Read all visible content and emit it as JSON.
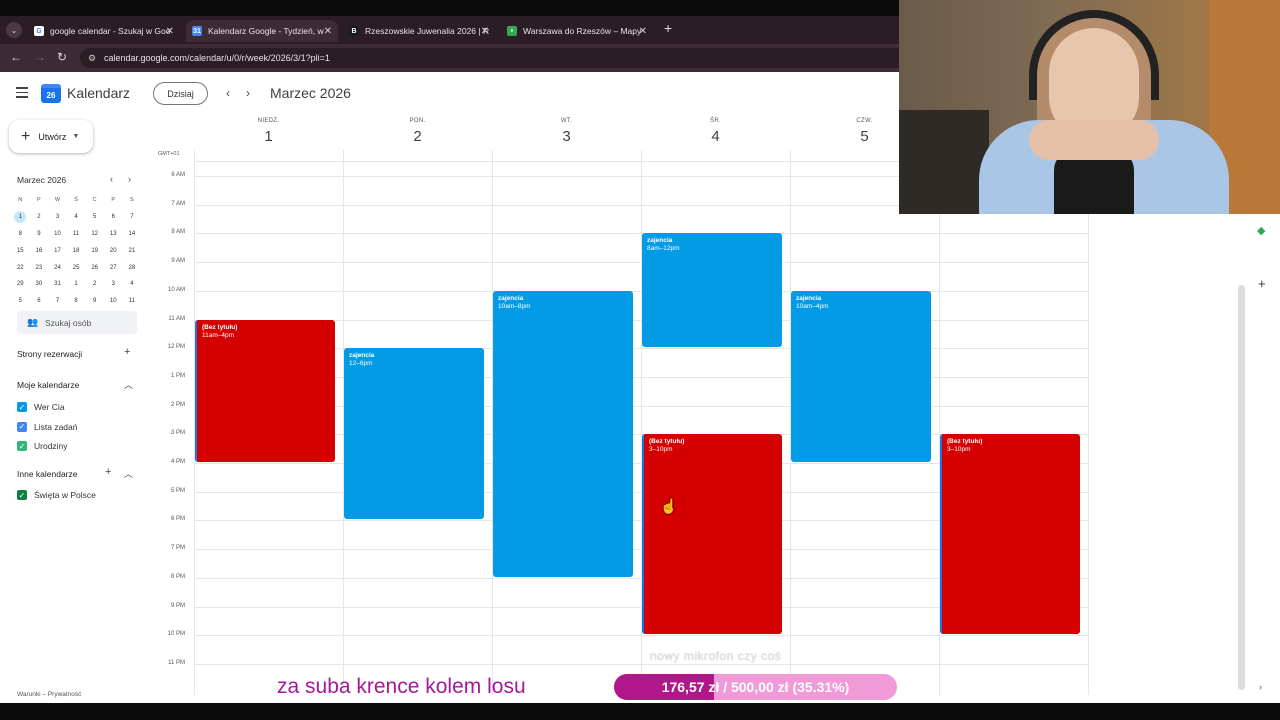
{
  "browser": {
    "tabs": [
      {
        "title": "google calendar - Szukaj w Goo",
        "fav_color": "#ffffff",
        "fav_text": "G"
      },
      {
        "title": "Kalendarz Google - Tydzień, w",
        "fav_color": "#4285f4",
        "fav_text": "31"
      },
      {
        "title": "Rzeszowskie Juwenalia 2026 | R",
        "fav_color": "#1b1b1b",
        "fav_text": "B"
      },
      {
        "title": "Warszawa do Rzeszów – Mapy",
        "fav_color": "#34a853",
        "fav_text": "•"
      }
    ],
    "active_tab": 1,
    "url": "calendar.google.com/calendar/u/0/r/week/2026/3/1?pli=1"
  },
  "header": {
    "app_name": "Kalendarz",
    "logo_text": "26",
    "today_label": "Dzisiaj",
    "period": "Marzec 2026"
  },
  "sidebar": {
    "create_label": "Utwórz",
    "mini_cal": {
      "title": "Marzec 2026",
      "day_headers": [
        "N",
        "P",
        "W",
        "Ś",
        "C",
        "P",
        "S"
      ],
      "weeks": [
        [
          "1",
          "2",
          "3",
          "4",
          "5",
          "6",
          "7"
        ],
        [
          "8",
          "9",
          "10",
          "11",
          "12",
          "13",
          "14"
        ],
        [
          "15",
          "16",
          "17",
          "18",
          "19",
          "20",
          "21"
        ],
        [
          "22",
          "23",
          "24",
          "25",
          "26",
          "27",
          "28"
        ],
        [
          "29",
          "30",
          "31",
          "1",
          "2",
          "3",
          "4"
        ],
        [
          "5",
          "6",
          "7",
          "8",
          "9",
          "10",
          "11"
        ]
      ],
      "selected": "1"
    },
    "search_people": "Szukaj osób",
    "booking_pages": "Strony rezerwacji",
    "my_calendars_title": "Moje kalendarze",
    "my_calendars": [
      {
        "name": "Wer Cia",
        "color": "#039be5"
      },
      {
        "name": "Lista zadań",
        "color": "#4285f4"
      },
      {
        "name": "Urodziny",
        "color": "#33b679"
      }
    ],
    "other_calendars_title": "Inne kalendarze",
    "other_calendars": [
      {
        "name": "Święta w Polsce",
        "color": "#0b8043"
      }
    ],
    "footer": "Warunki – Prywatność"
  },
  "grid": {
    "timezone": "GMT+01",
    "days": [
      {
        "name": "NIEDZ.",
        "num": "1"
      },
      {
        "name": "PON.",
        "num": "2"
      },
      {
        "name": "WT.",
        "num": "3"
      },
      {
        "name": "ŚR.",
        "num": "4"
      },
      {
        "name": "CZW.",
        "num": "5"
      }
    ],
    "hours": [
      "6 AM",
      "7 AM",
      "8 AM",
      "9 AM",
      "10 AM",
      "11 AM",
      "12 PM",
      "1 PM",
      "2 PM",
      "3 PM",
      "4 PM",
      "5 PM",
      "6 PM",
      "7 PM",
      "8 PM",
      "9 PM",
      "10 PM",
      "11 PM"
    ],
    "events": [
      {
        "title": "(Bez tytułu)",
        "time": "11am–4pm",
        "color": "red",
        "col": 0,
        "start": 11,
        "end": 16
      },
      {
        "title": "zajencia",
        "time": "12–6pm",
        "color": "blue",
        "col": 1,
        "start": 12,
        "end": 18
      },
      {
        "title": "zajencia",
        "time": "10am–8pm",
        "color": "blue",
        "col": 2,
        "start": 10,
        "end": 20
      },
      {
        "title": "zajencia",
        "time": "8am–12pm",
        "color": "blue",
        "col": 3,
        "start": 8,
        "end": 12
      },
      {
        "title": "(Bez tytułu)",
        "time": "3–10pm",
        "color": "red",
        "col": 3,
        "start": 15,
        "end": 22
      },
      {
        "title": "zajencia",
        "time": "10am–4pm",
        "color": "blue",
        "col": 4,
        "start": 10,
        "end": 16
      },
      {
        "title": "(Bez tytułu)",
        "time": "3–10pm",
        "color": "red",
        "col": 5,
        "start": 15,
        "end": 22
      }
    ]
  },
  "overlay": {
    "promo_text": "za suba krence kolem losu",
    "goal_subtitle": "nowy mikrofon czy coś",
    "goal_text": "176,57 zł / 500,00 zł (35.31%)",
    "goal_fraction": 0.3531
  }
}
